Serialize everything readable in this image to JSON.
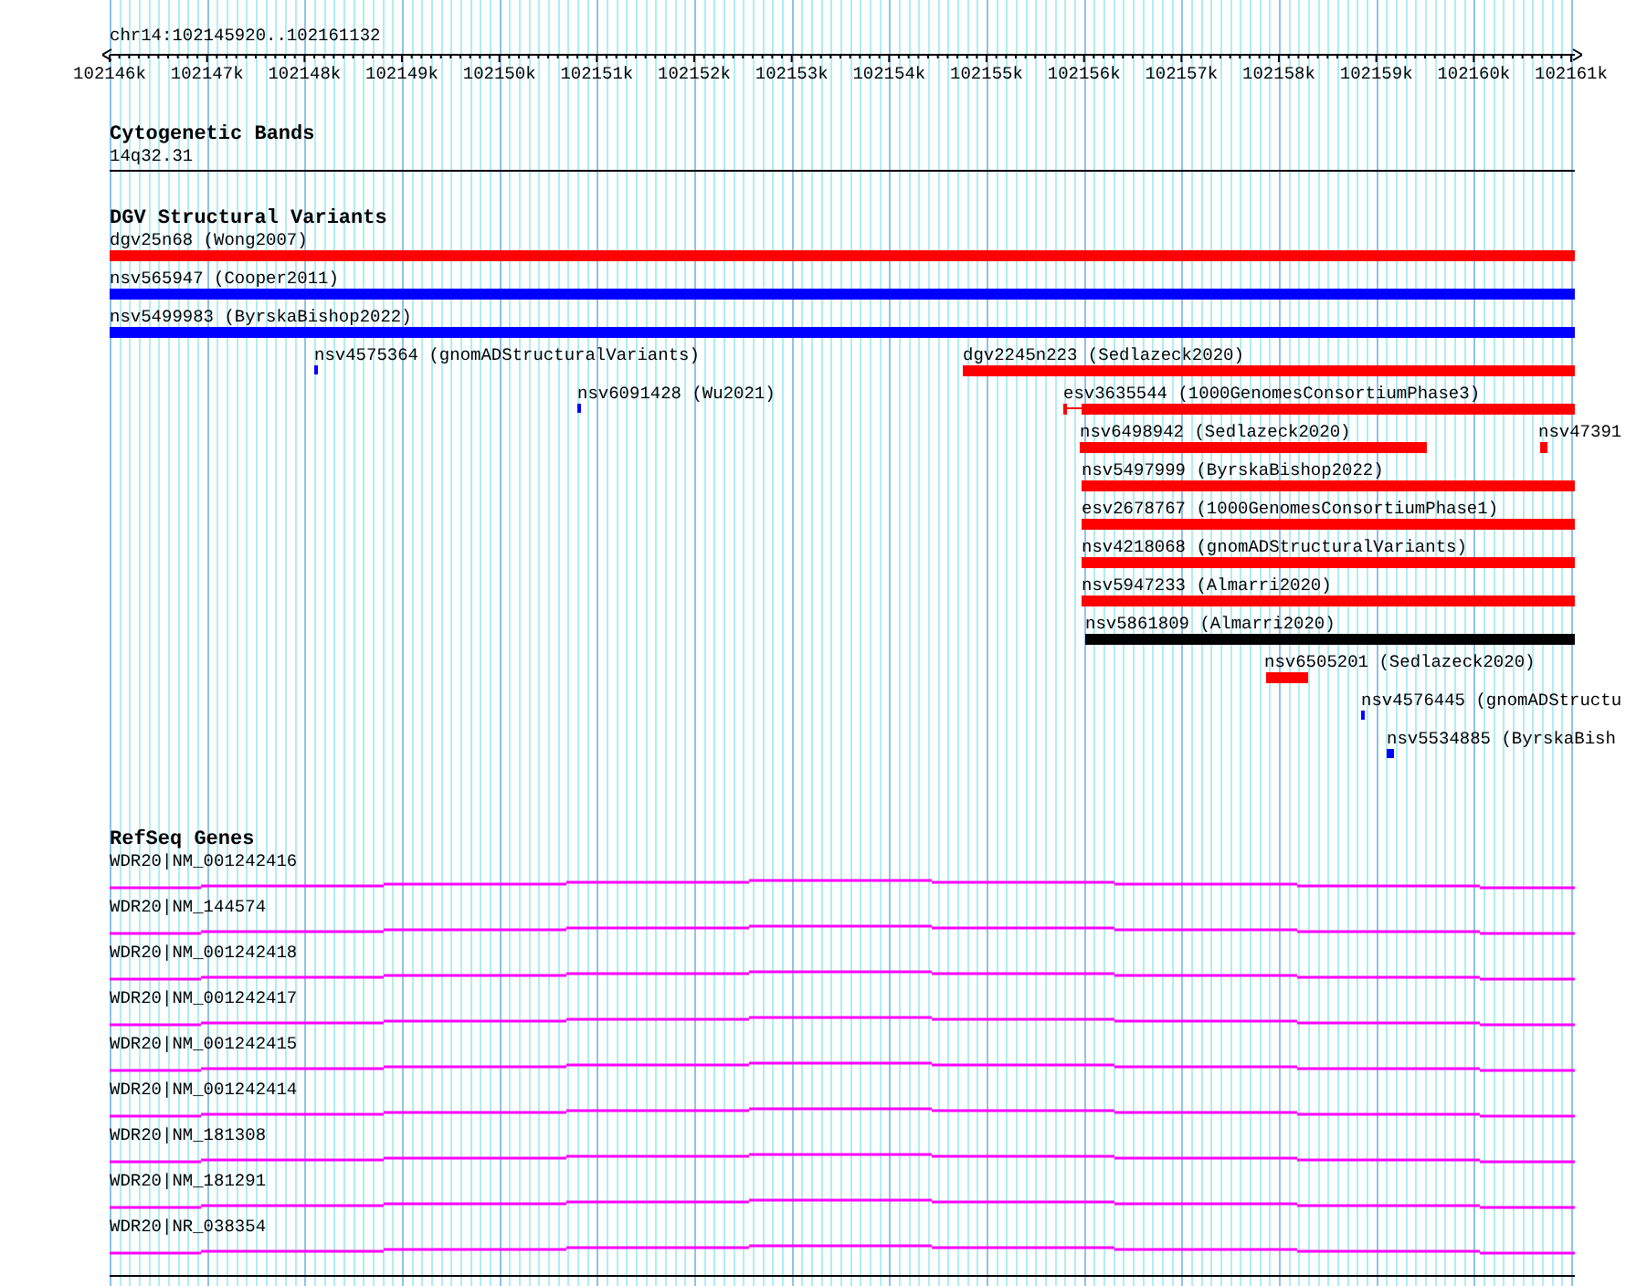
{
  "ruler": {
    "position": "chr14:102145920..102161132",
    "ticks": [
      "102146k",
      "102147k",
      "102148k",
      "102149k",
      "102150k",
      "102151k",
      "102152k",
      "102153k",
      "102154k",
      "102155k",
      "102156k",
      "102157k",
      "102158k",
      "102159k",
      "102160k",
      "102161k"
    ]
  },
  "tracks": [
    {
      "kind": "bands",
      "title": "Cytogenetic Bands",
      "bands": [
        {
          "label": "14q32.31"
        }
      ]
    },
    {
      "kind": "variants",
      "title": "DGV Structural Variants",
      "features": [
        {
          "label": "dgv25n68 (Wong2007)",
          "color": "#ff0000"
        },
        {
          "label": "nsv565947 (Cooper2011)",
          "color": "#0000ff"
        },
        {
          "label": "nsv5499983 (ByrskaBishop2022)",
          "color": "#0000ff"
        },
        {
          "label": "nsv4575364 (gnomADStructuralVariants)",
          "color": "#0000ff"
        },
        {
          "label": "dgv2245n223 (Sedlazeck2020)",
          "color": "#ff0000"
        },
        {
          "label": "nsv6091428 (Wu2021)",
          "color": "#0000ff"
        },
        {
          "label": "esv3635544 (1000GenomesConsortiumPhase3)",
          "color": "#ff0000"
        },
        {
          "label": "nsv6498942 (Sedlazeck2020)",
          "color": "#ff0000"
        },
        {
          "label": "nsv47391",
          "color": "#ff0000"
        },
        {
          "label": "nsv5497999 (ByrskaBishop2022)",
          "color": "#ff0000"
        },
        {
          "label": "esv2678767 (1000GenomesConsortiumPhase1)",
          "color": "#ff0000"
        },
        {
          "label": "nsv4218068 (gnomADStructuralVariants)",
          "color": "#ff0000"
        },
        {
          "label": "nsv5947233 (Almarri2020)",
          "color": "#ff0000"
        },
        {
          "label": "nsv5861809 (Almarri2020)",
          "color": "#000000"
        },
        {
          "label": "nsv6505201 (Sedlazeck2020)",
          "color": "#ff0000"
        },
        {
          "label": "nsv4576445 (gnomADStructu",
          "color": "#0000ff"
        },
        {
          "label": "nsv5534885 (ByrskaBish",
          "color": "#0000ff"
        }
      ]
    },
    {
      "kind": "genes",
      "title": "RefSeq Genes",
      "features": [
        {
          "label": "WDR20|NM_001242416"
        },
        {
          "label": "WDR20|NM_144574"
        },
        {
          "label": "WDR20|NM_001242418"
        },
        {
          "label": "WDR20|NM_001242417"
        },
        {
          "label": "WDR20|NM_001242415"
        },
        {
          "label": "WDR20|NM_001242414"
        },
        {
          "label": "WDR20|NM_181308"
        },
        {
          "label": "WDR20|NM_181291"
        },
        {
          "label": "WDR20|NR_038354"
        }
      ]
    }
  ]
}
